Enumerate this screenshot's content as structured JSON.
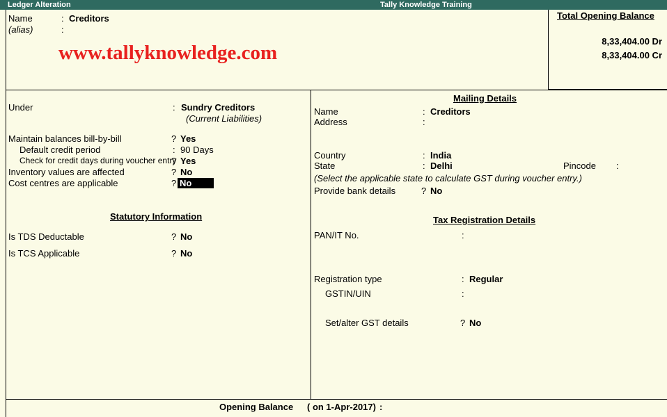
{
  "titlebar": {
    "left": "Ledger Alteration",
    "center": "Tally Knowledge Training"
  },
  "header": {
    "name_label": "Name",
    "name_value": "Creditors",
    "alias_label": "(alias)",
    "watermark": "www.tallyknowledge.com"
  },
  "balance_box": {
    "title": "Total Opening Balance",
    "dr": "8,33,404.00 Dr",
    "cr": "8,33,404.00 Cr"
  },
  "left": {
    "under_label": "Under",
    "under_value": "Sundry Creditors",
    "under_sub": "(Current Liabilities)",
    "bill_label": "Maintain balances bill-by-bill",
    "bill_value": "Yes",
    "credit_period_label": "Default credit period",
    "credit_period_value": "90 Days",
    "credit_days_label": "Check for credit days during voucher entry",
    "credit_days_value": "Yes",
    "inventory_label": "Inventory values are affected",
    "inventory_value": "No",
    "cost_label": "Cost centres are applicable",
    "cost_value": "No",
    "statutory_title": "Statutory Information",
    "tds_label": "Is TDS Deductable",
    "tds_value": "No",
    "tcs_label": "Is TCS Applicable",
    "tcs_value": "No"
  },
  "right": {
    "mailing_title": "Mailing Details",
    "name_label": "Name",
    "name_value": "Creditors",
    "address_label": "Address",
    "country_label": "Country",
    "country_value": "India",
    "state_label": "State",
    "state_value": "Delhi",
    "pincode_label": "Pincode",
    "gst_note": "(Select the applicable state to calculate GST during voucher entry.)",
    "bank_label": "Provide bank details",
    "bank_value": "No",
    "tax_title": "Tax Registration Details",
    "pan_label": "PAN/IT No.",
    "reg_type_label": "Registration type",
    "reg_type_value": "Regular",
    "gstin_label": "GSTIN/UIN",
    "gst_details_label": "Set/alter GST details",
    "gst_details_value": "No"
  },
  "footer": {
    "label": "Opening Balance",
    "date": "( on 1-Apr-2017)"
  }
}
